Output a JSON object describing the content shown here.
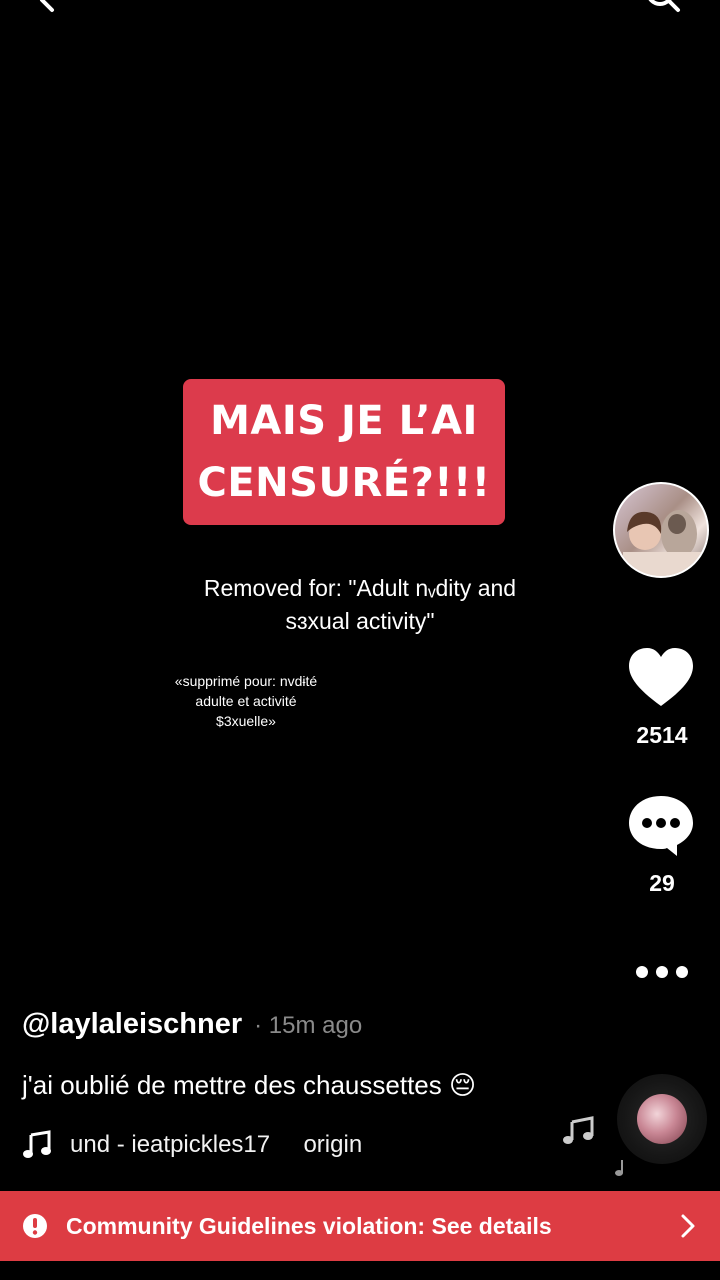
{
  "top_bar": {
    "back_icon": "chevron-left-icon",
    "search_icon": "search-icon"
  },
  "video": {
    "sticker_text": "MAIS JE L’AI\nCENSURÉ?!!!",
    "removed_text": "Removed for: \"Adult nᵥdity and\nsɜxual activity\"",
    "overlay_text_fr": "«supprimé pour: nvdɨté\nadulte et activité\n$3xuelle»"
  },
  "sidebar": {
    "avatar_icon": "profile-avatar",
    "like_icon": "heart-icon",
    "like_count": "2514",
    "comment_icon": "comment-icon",
    "comment_count": "29",
    "more_icon": "more-dots-icon"
  },
  "post": {
    "username": "@laylaleischner",
    "time": "· 15m ago",
    "caption": "j'ai oublié de mettre des chaussettes 😔",
    "music_icon": "music-note-icon",
    "music_text": "und - ieatpickles17     origin"
  },
  "banner": {
    "icon": "alert-icon",
    "text": "Community Guidelines violation: See details",
    "chevron_icon": "chevron-right-icon",
    "color": "#dd3c43"
  },
  "colors": {
    "background": "#000000",
    "sticker": "#dc3b4c"
  }
}
